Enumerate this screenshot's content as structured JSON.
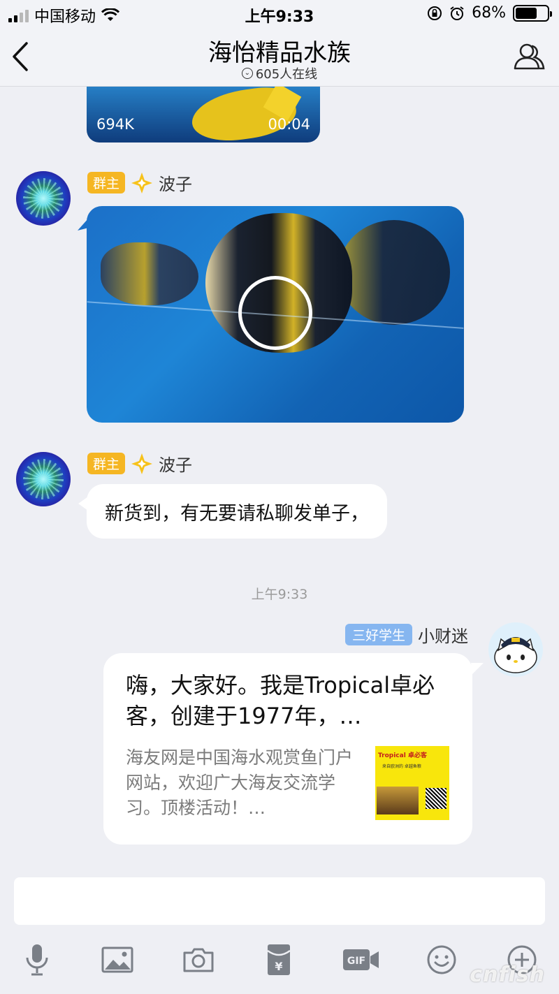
{
  "status_bar": {
    "carrier": "中国移动",
    "time": "上午9:33",
    "battery": "68%",
    "battery_level": 0.68
  },
  "header": {
    "title": "海怡精品水族",
    "online": "605人在线"
  },
  "messages": {
    "video_top": {
      "size": "694K",
      "duration": "00:04"
    },
    "video_post": {
      "badge": "群主",
      "sender": "波子"
    },
    "text_post": {
      "badge": "群主",
      "sender": "波子",
      "text": "新货到，有无要请私聊发单子，"
    },
    "timestamp": "上午9:33",
    "share_post": {
      "badge": "三好学生",
      "sender": "小财迷",
      "card_title": "嗨，大家好。我是Tropical卓必客，创建于1977年，…",
      "card_desc": "海友网是中国海水观赏鱼门户网站，欢迎广大海友交流学习。顶楼活动！…",
      "thumb_brand": "Tropical 卓必客",
      "thumb_sub": "来自欧洲的 卓越鱼粮"
    }
  },
  "input": {
    "placeholder": ""
  },
  "toolbar": {
    "icons": [
      "microphone-icon",
      "image-icon",
      "camera-icon",
      "red-packet-icon",
      "gif-icon",
      "emoji-icon",
      "plus-icon"
    ],
    "gif_label": "GIF"
  },
  "watermark": "cnfish",
  "colors": {
    "owner_badge": "#f5b623",
    "student_badge": "#86b6f0",
    "background": "#eeeff4"
  }
}
